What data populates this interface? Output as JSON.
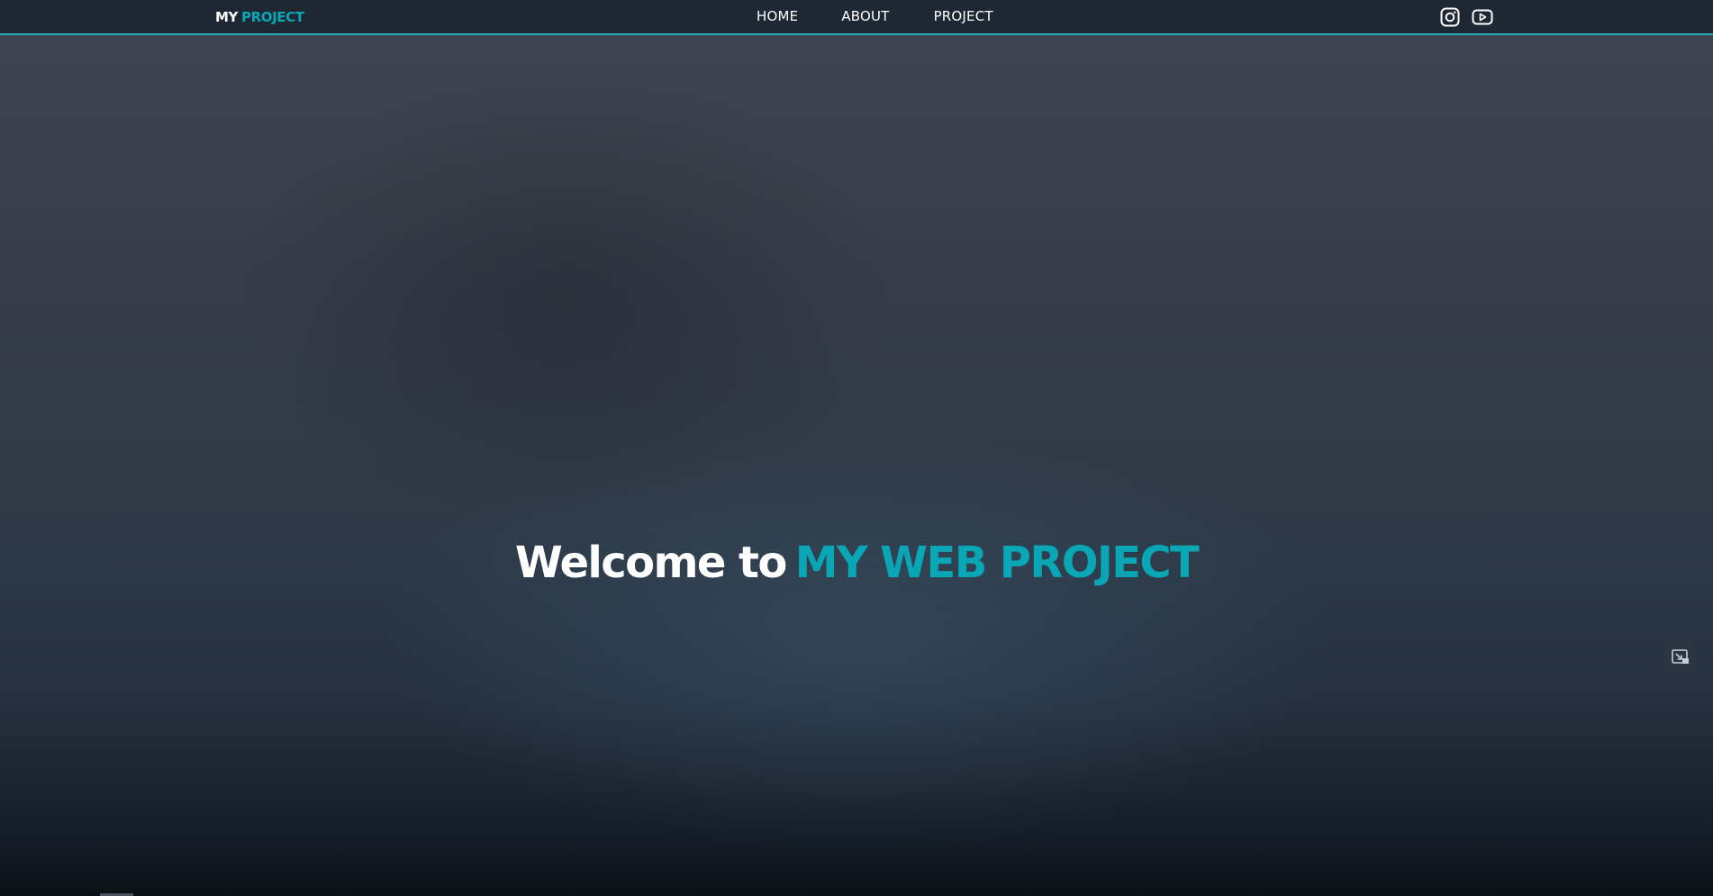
{
  "header": {
    "logo": {
      "part1": "MY",
      "part2": "PROJECT"
    },
    "nav": [
      {
        "label": "HOME"
      },
      {
        "label": "ABOUT"
      },
      {
        "label": "PROJECT"
      }
    ],
    "social": [
      {
        "icon": "instagram-icon"
      },
      {
        "icon": "youtube-icon"
      }
    ]
  },
  "hero": {
    "title_white": "Welcome to",
    "title_accent": "MY WEB PROJECT"
  },
  "controls": {
    "pip_icon": "picture-in-picture-icon"
  },
  "colors": {
    "accent": "#0aa8b6",
    "navbar_bg": "#1e2734",
    "navbar_border": "#24aab2",
    "text_white": "#ffffff"
  }
}
